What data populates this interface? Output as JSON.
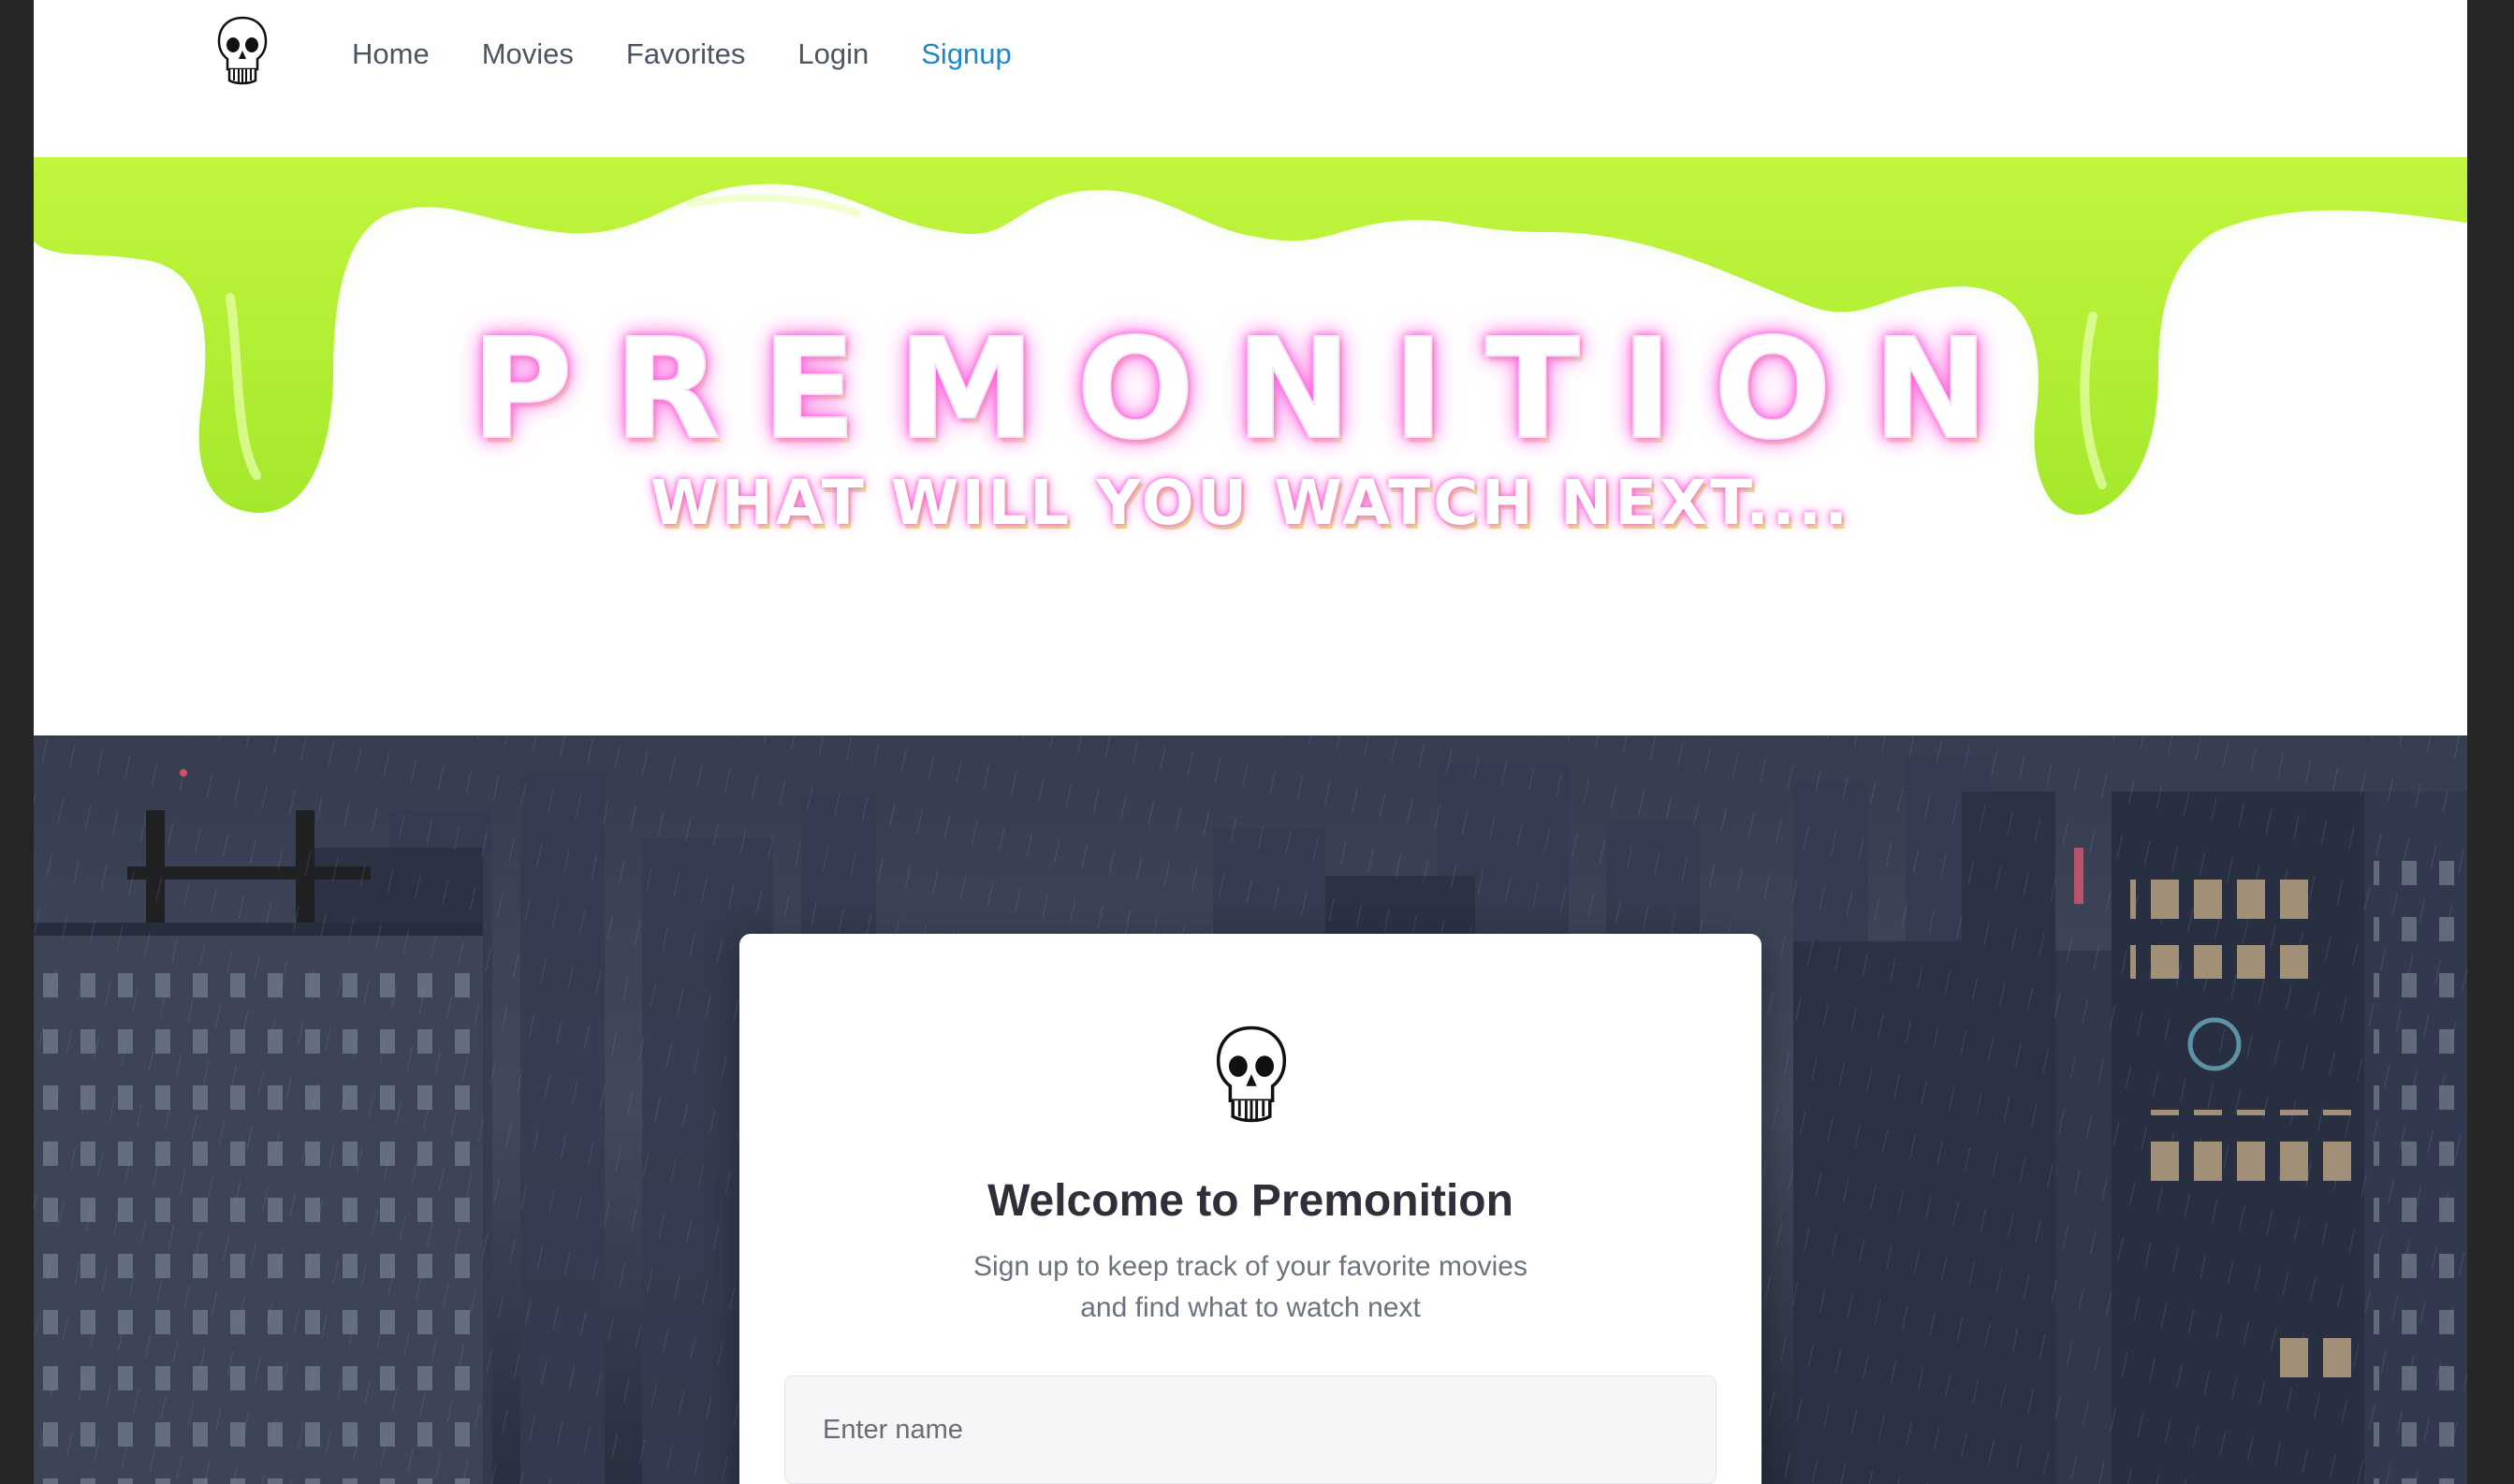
{
  "nav": {
    "logo_icon": "skull-icon",
    "links": [
      {
        "label": "Home",
        "active": false
      },
      {
        "label": "Movies",
        "active": false
      },
      {
        "label": "Favorites",
        "active": false
      },
      {
        "label": "Login",
        "active": false
      },
      {
        "label": "Signup",
        "active": true
      }
    ],
    "active_color": "#1e88c9"
  },
  "hero": {
    "title": "PREMONITION",
    "subtitle": "WHAT WILL YOU WATCH NEXT....",
    "slime_color": "#b8f23a",
    "glow_color": "#ff4fd8"
  },
  "signup": {
    "logo_icon": "skull-icon",
    "title": "Welcome to Premonition",
    "subtitle_line1": "Sign up to keep track of your favorite movies",
    "subtitle_line2": "and find what to watch next",
    "name_placeholder": "Enter name"
  }
}
